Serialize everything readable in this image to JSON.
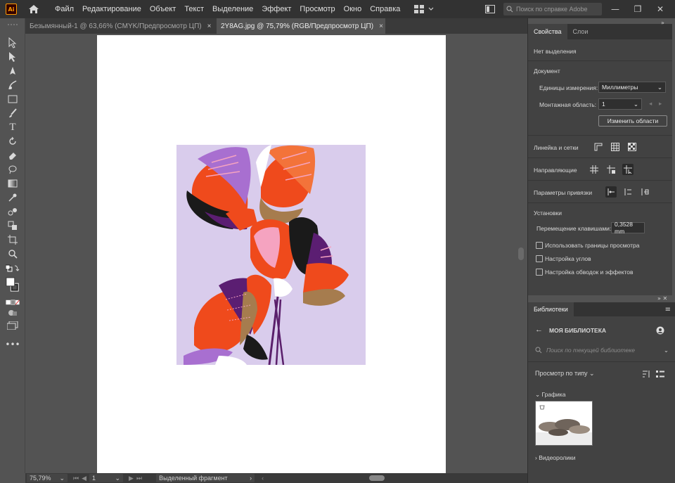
{
  "app": {
    "logo_text": "Ai"
  },
  "menu": {
    "items": [
      "Файл",
      "Редактирование",
      "Объект",
      "Текст",
      "Выделение",
      "Эффект",
      "Просмотр",
      "Окно",
      "Справка"
    ],
    "help_search_placeholder": "Поиск по справке Adobe"
  },
  "tabs": [
    {
      "label": "Безымянный-1 @ 63,66% (CMYK/Предпросмотр ЦП)",
      "active": false,
      "close": "×"
    },
    {
      "label": "2Y8AG.jpg @ 75,79% (RGB/Предпросмотр ЦП)",
      "active": true,
      "close": "×"
    }
  ],
  "status": {
    "zoom": "75,79%",
    "artboard": "1",
    "mode": "Выделенный фрагмент"
  },
  "properties": {
    "tabs": [
      "Свойства",
      "Слои"
    ],
    "no_selection": "Нет выделения",
    "document_title": "Документ",
    "units_label": "Единицы измерения:",
    "units_value": "Миллиметры",
    "artboard_label": "Монтажная область:",
    "artboard_value": "1",
    "edit_artboards_button": "Изменить области",
    "rulers_label": "Линейка и сетки",
    "guides_label": "Направляющие",
    "snap_label": "Параметры привязки",
    "settings_title": "Установки",
    "keyboard_increment_label": "Перемещение клавишами:",
    "keyboard_increment_value": "0,3528 mm",
    "checkboxes": [
      "Использовать границы просмотра",
      "Настройка углов",
      "Настройка обводок и эффектов"
    ]
  },
  "libraries": {
    "tab": "Библиотеки",
    "library_name": "МОЯ БИБЛИОТЕКА",
    "search_placeholder": "Поиск по текущей библиотеке",
    "view_by": "Просмотр по типу",
    "graphics_section": "Графика",
    "videos_section": "Видеоролики"
  },
  "colors": {
    "accent_orange": "#ff9a00",
    "artwork_background": "#d9ccec"
  }
}
